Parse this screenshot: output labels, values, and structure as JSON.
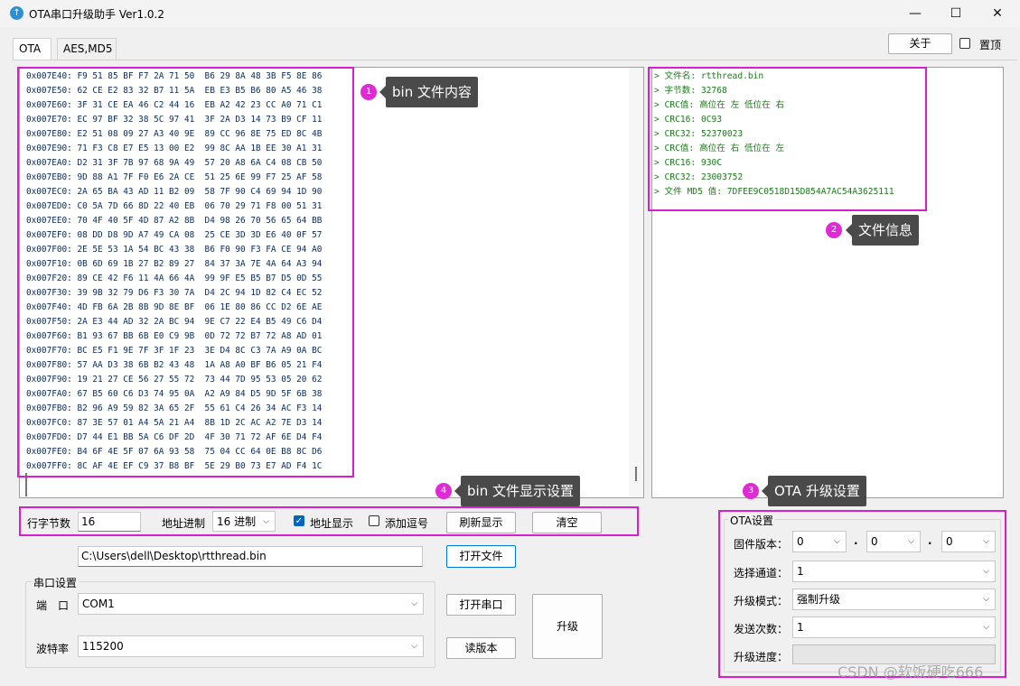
{
  "window": {
    "title": "OTA串口升级助手 Ver1.0.2",
    "minimize": "—",
    "maximize": "☐",
    "close": "✕"
  },
  "tabs": [
    {
      "label": "OTA"
    },
    {
      "label": "AES,MD5"
    }
  ],
  "top_right": {
    "about_label": "关于",
    "pin_label": "置顶"
  },
  "hex_lines": [
    "0x007E40: F9 51 85 BF F7 2A 71 50  B6 29 8A 48 3B F5 8E 86",
    "0x007E50: 62 CE E2 83 32 B7 11 5A  EB E3 B5 B6 80 A5 46 38",
    "0x007E60: 3F 31 CE EA 46 C2 44 16  EB A2 42 23 CC A0 71 C1",
    "0x007E70: EC 97 BF 32 38 5C 97 41  3F 2A D3 14 73 B9 CF 11",
    "0x007E80: E2 51 08 09 27 A3 40 9E  89 CC 96 8E 75 ED 8C 4B",
    "0x007E90: 71 F3 C8 E7 E5 13 00 E2  99 8C AA 1B EE 30 A1 31",
    "0x007EA0: D2 31 3F 7B 97 68 9A 49  57 20 A8 6A C4 08 CB 50",
    "0x007EB0: 9D 88 A1 7F F0 E6 2A CE  51 25 6E 99 F7 25 AF 58",
    "0x007EC0: 2A 65 BA 43 AD 11 B2 09  58 7F 90 C4 69 94 1D 90",
    "0x007ED0: C0 5A 7D 66 8D 22 40 EB  06 70 29 71 F8 00 51 31",
    "0x007EE0: 70 4F 40 5F 4D 87 A2 8B  D4 98 26 70 56 65 64 BB",
    "0x007EF0: 08 DD D8 9D A7 49 CA 08  25 CE 3D 3D E6 40 0F 57",
    "0x007F00: 2E 5E 53 1A 54 BC 43 38  B6 F0 90 F3 FA CE 94 A0",
    "0x007F10: 0B 6D 69 1B 27 B2 89 27  84 37 3A 7E 4A 64 A3 94",
    "0x007F20: 89 CE 42 F6 11 4A 66 4A  99 9F E5 B5 B7 D5 0D 55",
    "0x007F30: 39 9B 32 79 D6 F3 30 7A  D4 2C 94 1D 82 C4 EC 52",
    "0x007F40: 4D FB 6A 2B 8B 9D 8E BF  06 1E 80 86 CC D2 6E AE",
    "0x007F50: 2A E3 44 AD 32 2A BC 94  9E C7 22 E4 B5 49 C6 D4",
    "0x007F60: B1 93 67 BB 6B E0 C9 9B  0D 72 72 B7 72 A8 AD 01",
    "0x007F70: BC E5 F1 9E 7F 3F 1F 23  3E D4 8C C3 7A A9 0A BC",
    "0x007F80: 57 AA D3 38 6B B2 43 48  1A A8 A0 BF B6 05 21 F4",
    "0x007F90: 19 21 27 CE 56 27 55 72  73 44 7D 95 53 05 20 62",
    "0x007FA0: 67 B5 60 C6 D3 74 95 0A  A2 A9 84 D5 9D 5F 6B 38",
    "0x007FB0: B2 96 A9 59 82 3A 65 2F  55 61 C4 26 34 AC F3 14",
    "0x007FC0: 87 3E 57 01 A4 5A 21 A4  8B 1D 2C AC A2 7E D3 14",
    "0x007FD0: D7 44 E1 BB 5A C6 DF 2D  4F 30 71 72 AF 6E D4 F4",
    "0x007FE0: B4 6F 4E 5F 07 6A 93 58  75 04 CC 64 0E B8 8C D6",
    "0x007FF0: 8C AF 4E EF C9 37 B8 BF  5E 29 B0 73 E7 AD F4 1C"
  ],
  "info_lines": [
    "> 文件名: rtthread.bin",
    "> 字节数: 32768",
    "> CRC值: 高位在 左 低位在 右",
    "> CRC16: 0C93",
    "> CRC32: 52370023",
    "> CRC值: 高位在 右 低位在 左",
    "> CRC16: 930C",
    "> CRC32: 23003752",
    "> 文件 MD5 值: 7DFEE9C0518D15D854A7AC54A3625111"
  ],
  "annotations": [
    {
      "num": "1",
      "text": "bin 文件内容"
    },
    {
      "num": "2",
      "text": "文件信息"
    },
    {
      "num": "3",
      "text": "OTA 升级设置"
    },
    {
      "num": "4",
      "text": "bin 文件显示设置"
    }
  ],
  "display_settings": {
    "bytes_per_line_label": "行字节数",
    "bytes_per_line_value": "16",
    "address_radix_label": "地址进制",
    "address_radix_value": "16 进制",
    "show_address_label": "地址显示",
    "show_address_checked": true,
    "add_comma_label": "添加逗号",
    "add_comma_checked": false,
    "refresh_label": "刷新显示",
    "clear_label": "清空"
  },
  "file": {
    "path": "C:\\Users\\dell\\Desktop\\rtthread.bin",
    "open_label": "打开文件"
  },
  "serial": {
    "group_title": "串口设置",
    "port_label": "端　口",
    "port_value": "COM1",
    "baud_label": "波特率",
    "baud_value": "115200",
    "open_port_label": "打开串口",
    "read_version_label": "读版本",
    "upgrade_label": "升级"
  },
  "ota": {
    "group_title": "OTA设置",
    "fw_version_label": "固件版本：",
    "fw_v1": "0",
    "fw_v2": "0",
    "fw_v3": "0",
    "dot": ".",
    "channel_label": "选择通道：",
    "channel_value": "1",
    "mode_label": "升级模式：",
    "mode_value": "强制升级",
    "send_count_label": "发送次数：",
    "send_count_value": "1",
    "progress_label": "升级进度：",
    "progress": 0
  },
  "watermark": "CSDN @软饭硬吃666"
}
